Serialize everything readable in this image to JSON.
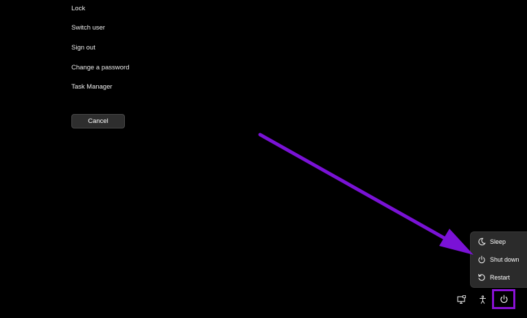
{
  "options_menu": {
    "items": [
      {
        "label": "Lock"
      },
      {
        "label": "Switch user"
      },
      {
        "label": "Sign out"
      },
      {
        "label": "Change a password"
      },
      {
        "label": "Task Manager"
      }
    ],
    "cancel_label": "Cancel"
  },
  "power_menu": {
    "items": [
      {
        "label": "Sleep",
        "icon": "moon-icon"
      },
      {
        "label": "Shut down",
        "icon": "power-icon"
      },
      {
        "label": "Restart",
        "icon": "restart-icon"
      }
    ]
  },
  "tray": {
    "icons": [
      "network-icon",
      "accessibility-icon",
      "power-icon"
    ]
  },
  "annotation": {
    "highlight_color": "#8b12d6",
    "arrow_color": "#7a12d6"
  }
}
